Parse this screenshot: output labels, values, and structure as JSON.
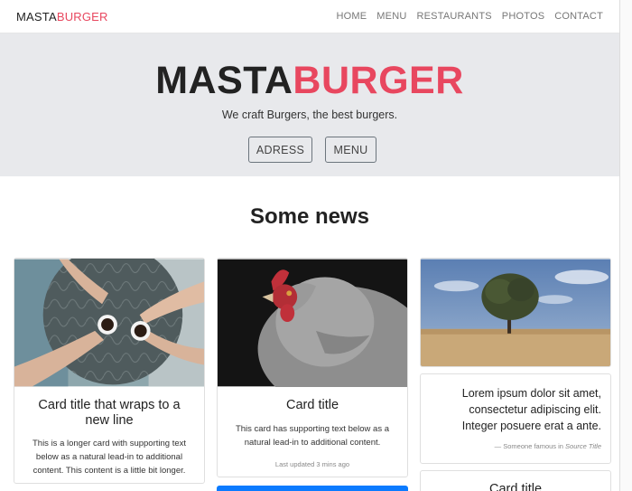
{
  "navbar": {
    "brand_part1": "MASTA",
    "brand_part2": "BURGER",
    "links": [
      "HOME",
      "MENU",
      "RESTAURANTS",
      "PHOTOS",
      "CONTACT"
    ]
  },
  "hero": {
    "title_part1": "MASTA",
    "title_part2": "BURGER",
    "subtitle": "We craft Burgers, the best burgers.",
    "button_adress": "ADRESS",
    "button_menu": "MENU"
  },
  "news": {
    "heading": "Some news",
    "cards": [
      {
        "title": "Card title that wraps to a new line",
        "text": "This is a longer card with supporting text below as a natural lead-in to additional content. This content is a little bit longer."
      },
      {
        "title": "Card title",
        "text": "This card has supporting text below as a natural lead-in to additional content.",
        "muted": "Last updated 3 mins ago"
      },
      {
        "quote": "Lorem ipsum dolor sit amet, consectetur adipiscing elit. Integer posuere erat a ante.",
        "footer_prefix": "— Someone famous in ",
        "footer_source": "Source Title"
      },
      {
        "title": "Card title"
      }
    ]
  },
  "colors": {
    "accent": "#e8475f",
    "hero_bg": "#e8e9ec",
    "primary_button": "#0b7bff"
  }
}
